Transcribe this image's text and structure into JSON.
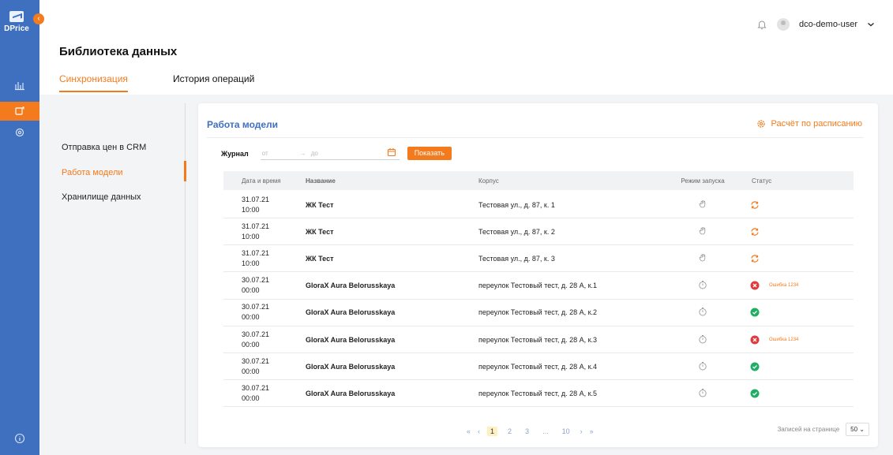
{
  "colors": {
    "brand": "#3f6fbf",
    "accent": "#f37b1d",
    "success": "#1fae63",
    "error": "#e0393e"
  },
  "app": {
    "logo_text": "DPrice",
    "collapse_icon": "chevron-left-icon"
  },
  "sidebar": {
    "nav": [
      {
        "icon": "chart-icon",
        "active": false
      },
      {
        "icon": "home-icon",
        "active": false
      },
      {
        "icon": "library-icon",
        "active": true
      },
      {
        "icon": "settings-icon",
        "active": false
      }
    ],
    "bottom_icon": "info-icon"
  },
  "header": {
    "username": "dco-demo-user",
    "bell_icon": "bell-icon",
    "avatar_icon": "avatar-icon"
  },
  "page": {
    "title": "Библиотека данных",
    "tabs": [
      {
        "label": "Синхронизация",
        "active": true
      },
      {
        "label": "История операций",
        "active": false
      }
    ]
  },
  "left_menu": [
    {
      "label": "Отправка цен в CRM",
      "active": false
    },
    {
      "label": "Работа модели",
      "active": true
    },
    {
      "label": "Хранилище данных",
      "active": false
    }
  ],
  "card": {
    "title": "Работа модели",
    "schedule_label": "Расчёт по расписанию",
    "filter": {
      "label": "Журнал",
      "from_placeholder": "от",
      "to_placeholder": "до",
      "show_button": "Показать"
    },
    "columns": [
      "Дата и время",
      "Название",
      "Корпус",
      "Режим запуска",
      "Статус"
    ],
    "rows": [
      {
        "date": "31.07.21",
        "time": "10:00",
        "name": "ЖК Тест",
        "address": "Тестовая ул., д. 87, к. 1",
        "mode": "manual",
        "status": "syncing",
        "status_text": ""
      },
      {
        "date": "31.07.21",
        "time": "10:00",
        "name": "ЖК Тест",
        "address": "Тестовая ул., д. 87, к. 2",
        "mode": "manual",
        "status": "syncing",
        "status_text": ""
      },
      {
        "date": "31.07.21",
        "time": "10:00",
        "name": "ЖК Тест",
        "address": "Тестовая ул., д. 87, к. 3",
        "mode": "manual",
        "status": "syncing",
        "status_text": ""
      },
      {
        "date": "30.07.21",
        "time": "00:00",
        "name": "GloraX Aura Belorusskaya",
        "address": "переулок Тестовый тест, д. 28 А, к.1",
        "mode": "timer",
        "status": "error",
        "status_text": "Ошибка 1234"
      },
      {
        "date": "30.07.21",
        "time": "00:00",
        "name": "GloraX Aura Belorusskaya",
        "address": "переулок Тестовый тест, д. 28 А, к.2",
        "mode": "timer",
        "status": "success",
        "status_text": ""
      },
      {
        "date": "30.07.21",
        "time": "00:00",
        "name": "GloraX Aura Belorusskaya",
        "address": "переулок Тестовый тест, д. 28 А, к.3",
        "mode": "timer",
        "status": "error",
        "status_text": "Ошибка 1234"
      },
      {
        "date": "30.07.21",
        "time": "00:00",
        "name": "GloraX Aura Belorusskaya",
        "address": "переулок Тестовый тест, д. 28 А, к.4",
        "mode": "timer",
        "status": "success",
        "status_text": ""
      },
      {
        "date": "30.07.21",
        "time": "00:00",
        "name": "GloraX Aura Belorusskaya",
        "address": "переулок Тестовый тест, д. 28 А, к.5",
        "mode": "timer",
        "status": "success",
        "status_text": ""
      }
    ],
    "pagination": {
      "first": "«",
      "prev": "‹",
      "pages": [
        "1",
        "2",
        "3",
        "...",
        "10"
      ],
      "current": "1",
      "next": "›",
      "last": "»",
      "per_page_label": "Записей на странице",
      "per_page_value": "50"
    }
  }
}
